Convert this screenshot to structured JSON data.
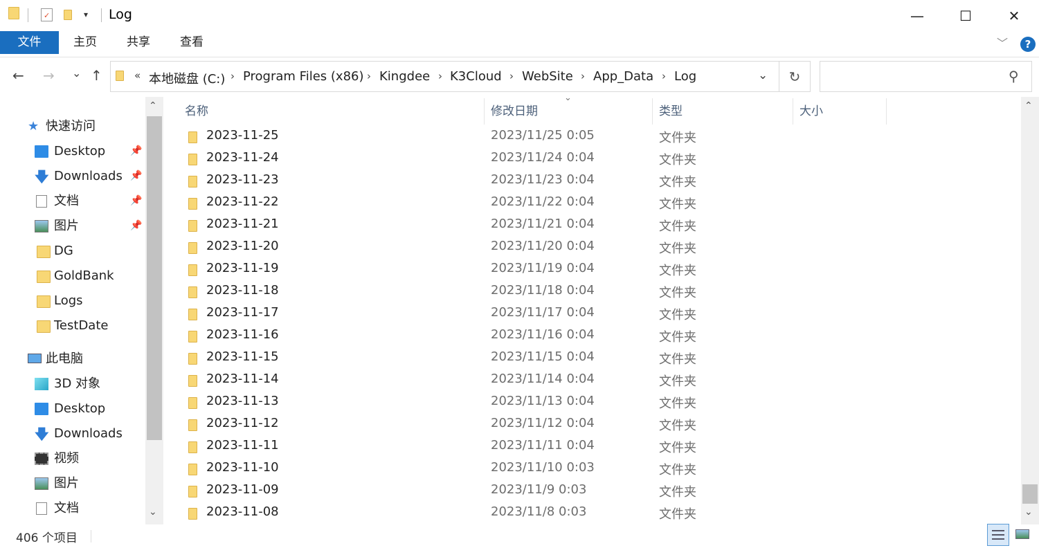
{
  "window": {
    "title": "Log",
    "minimize_label": "—",
    "maximize_label": "☐",
    "close_label": "✕"
  },
  "ribbon": {
    "tabs": [
      "文件",
      "主页",
      "共享",
      "查看"
    ],
    "help_label": "?",
    "expand_label": "﹀"
  },
  "nav": {
    "back": "←",
    "forward": "→",
    "recent": "⌄",
    "up": "↑",
    "breadcrumb_prefix": "«",
    "breadcrumbs": [
      "本地磁盘 (C:)",
      "Program Files (x86)",
      "Kingdee",
      "K3Cloud",
      "WebSite",
      "App_Data",
      "Log"
    ],
    "separator": "›",
    "dropdown": "⌄",
    "refresh": "↻",
    "search_placeholder": "",
    "search_icon": "⚲"
  },
  "sidebar": {
    "quick_access": {
      "label": "快速访问",
      "items": [
        {
          "label": "Desktop",
          "icon": "desktop-icon",
          "pinned": true
        },
        {
          "label": "Downloads",
          "icon": "download-icon",
          "pinned": true
        },
        {
          "label": "文档",
          "icon": "document-icon",
          "pinned": true
        },
        {
          "label": "图片",
          "icon": "picture-icon",
          "pinned": true
        },
        {
          "label": "DG",
          "icon": "folder-icon",
          "pinned": false
        },
        {
          "label": "GoldBank",
          "icon": "folder-icon",
          "pinned": false
        },
        {
          "label": "Logs",
          "icon": "folder-icon",
          "pinned": false
        },
        {
          "label": "TestDate",
          "icon": "folder-icon",
          "pinned": false
        }
      ]
    },
    "this_pc": {
      "label": "此电脑",
      "items": [
        {
          "label": "3D 对象",
          "icon": "3d-objects-icon"
        },
        {
          "label": "Desktop",
          "icon": "desktop-icon"
        },
        {
          "label": "Downloads",
          "icon": "download-icon"
        },
        {
          "label": "视频",
          "icon": "video-icon"
        },
        {
          "label": "图片",
          "icon": "picture-icon"
        },
        {
          "label": "文档",
          "icon": "document-icon"
        }
      ]
    },
    "pin_glyph": "📌",
    "scroll_up": "⌃",
    "scroll_down": "⌄"
  },
  "columns": {
    "name": "名称",
    "date": "修改日期",
    "type": "类型",
    "size": "大小",
    "sort_indicator": "⌄"
  },
  "files": [
    {
      "name": "2023-11-25",
      "date": "2023/11/25 0:05",
      "type": "文件夹"
    },
    {
      "name": "2023-11-24",
      "date": "2023/11/24 0:04",
      "type": "文件夹"
    },
    {
      "name": "2023-11-23",
      "date": "2023/11/23 0:04",
      "type": "文件夹"
    },
    {
      "name": "2023-11-22",
      "date": "2023/11/22 0:04",
      "type": "文件夹"
    },
    {
      "name": "2023-11-21",
      "date": "2023/11/21 0:04",
      "type": "文件夹"
    },
    {
      "name": "2023-11-20",
      "date": "2023/11/20 0:04",
      "type": "文件夹"
    },
    {
      "name": "2023-11-19",
      "date": "2023/11/19 0:04",
      "type": "文件夹"
    },
    {
      "name": "2023-11-18",
      "date": "2023/11/18 0:04",
      "type": "文件夹"
    },
    {
      "name": "2023-11-17",
      "date": "2023/11/17 0:04",
      "type": "文件夹"
    },
    {
      "name": "2023-11-16",
      "date": "2023/11/16 0:04",
      "type": "文件夹"
    },
    {
      "name": "2023-11-15",
      "date": "2023/11/15 0:04",
      "type": "文件夹"
    },
    {
      "name": "2023-11-14",
      "date": "2023/11/14 0:04",
      "type": "文件夹"
    },
    {
      "name": "2023-11-13",
      "date": "2023/11/13 0:04",
      "type": "文件夹"
    },
    {
      "name": "2023-11-12",
      "date": "2023/11/12 0:04",
      "type": "文件夹"
    },
    {
      "name": "2023-11-11",
      "date": "2023/11/11 0:04",
      "type": "文件夹"
    },
    {
      "name": "2023-11-10",
      "date": "2023/11/10 0:03",
      "type": "文件夹"
    },
    {
      "name": "2023-11-09",
      "date": "2023/11/9 0:03",
      "type": "文件夹"
    },
    {
      "name": "2023-11-08",
      "date": "2023/11/8 0:03",
      "type": "文件夹"
    }
  ],
  "status": {
    "item_count": "406 个项目"
  },
  "colors": {
    "accent": "#1a6ebf",
    "folder": "#f8d775",
    "header_text": "#4c607a"
  }
}
